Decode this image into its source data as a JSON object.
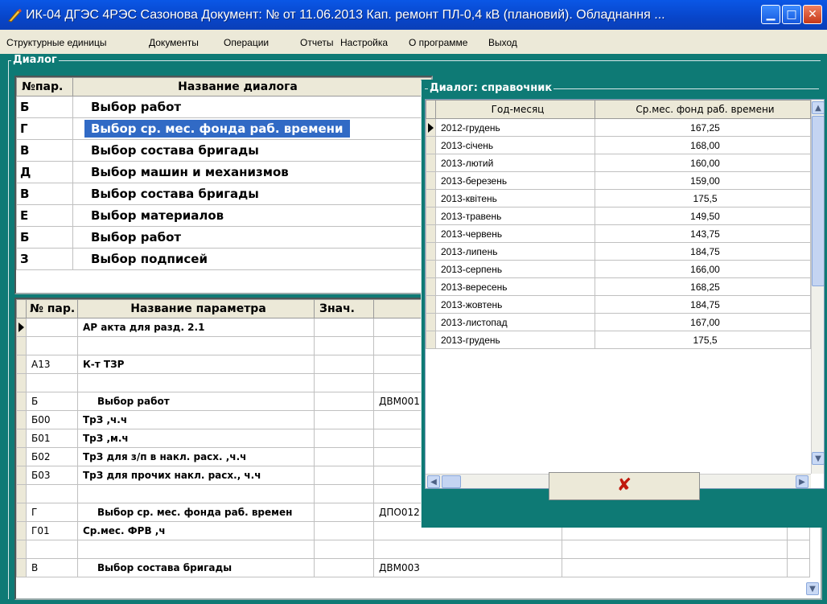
{
  "window": {
    "title": "ИК-04 ДГЭС 4РЭС Сазонова Документ: № от 11.06.2013   Кап. ремонт ПЛ-0,4 кВ (плановий). Обладнання ...",
    "minimize_glyph": "▁",
    "maximize_glyph": "□",
    "close_glyph": "✕"
  },
  "menu": [
    "Структурные единицы",
    "Документы",
    "Операции",
    "Отчеты",
    "Настройка",
    "О программе",
    "Выход"
  ],
  "dialogs_frame": {
    "label": "Диалог",
    "columns": [
      "№пар.",
      "Название диалога"
    ],
    "rows": [
      {
        "code": "Б",
        "name": "Выбор работ"
      },
      {
        "code": "Г",
        "name": "Выбор ср. мес. фонда раб. времени"
      },
      {
        "code": "В",
        "name": "Выбор состава бригады"
      },
      {
        "code": "Д",
        "name": "Выбор машин и механизмов"
      },
      {
        "code": "В",
        "name": "Выбор состава бригады"
      },
      {
        "code": "Е",
        "name": "Выбор материалов"
      },
      {
        "code": "Б",
        "name": "Выбор работ"
      },
      {
        "code": "З",
        "name": "Выбор подписей"
      }
    ],
    "selected_index": 1
  },
  "params": {
    "columns": [
      "№ пар.",
      "Название параметра",
      "Знач."
    ],
    "rows": [
      {
        "code": "",
        "name": "АР акта для разд. 2.1",
        "value": "",
        "extra": "",
        "current": true
      },
      {
        "code": "",
        "name": "",
        "value": "",
        "extra": ""
      },
      {
        "code": "А13",
        "name": "К-т ТЗР",
        "value": "",
        "extra": ""
      },
      {
        "code": "",
        "name": "",
        "value": "",
        "extra": ""
      },
      {
        "code": "Б",
        "name": "Выбор работ",
        "value": "",
        "extra": "ДВМ001"
      },
      {
        "code": "Б00",
        "name": "ТрЗ ,ч.ч",
        "value": "",
        "extra": ""
      },
      {
        "code": "Б01",
        "name": "ТрЗ ,м.ч",
        "value": "",
        "extra": ""
      },
      {
        "code": "Б02",
        "name": "ТрЗ для з/п в накл. расх. ,ч.ч",
        "value": "",
        "extra": ""
      },
      {
        "code": "Б03",
        "name": "ТрЗ для прочих накл. расх., ч.ч",
        "value": "",
        "extra": ""
      },
      {
        "code": "",
        "name": "",
        "value": "",
        "extra": ""
      },
      {
        "code": "Г",
        "name": "Выбор ср. мес. фонда раб. времен",
        "value": "",
        "extra": "ДПО012"
      },
      {
        "code": "Г01",
        "name": "Ср.мес. ФРВ ,ч",
        "value": "",
        "extra": ""
      },
      {
        "code": "",
        "name": "",
        "value": "",
        "extra": ""
      },
      {
        "code": "В",
        "name": "Выбор состава бригады",
        "value": "",
        "extra": "ДВМ003"
      }
    ]
  },
  "reference": {
    "label": "Диалог: справочник",
    "columns": [
      "Год-месяц",
      "Ср.мес. фонд раб. времени"
    ],
    "rows": [
      {
        "month": "2012-грудень",
        "value": "167,25",
        "current": true
      },
      {
        "month": "2013-січень",
        "value": "168,00"
      },
      {
        "month": "2013-лютий",
        "value": "160,00"
      },
      {
        "month": "2013-березень",
        "value": "159,00"
      },
      {
        "month": "2013-квітень",
        "value": "175,5"
      },
      {
        "month": "2013-травень",
        "value": "149,50"
      },
      {
        "month": "2013-червень",
        "value": "143,75"
      },
      {
        "month": "2013-липень",
        "value": "184,75"
      },
      {
        "month": "2013-серпень",
        "value": "166,00"
      },
      {
        "month": "2013-вересень",
        "value": "168,25"
      },
      {
        "month": "2013-жовтень",
        "value": "184,75"
      },
      {
        "month": "2013-листопад",
        "value": "167,00"
      },
      {
        "month": "2013-грудень",
        "value": "175,5"
      }
    ],
    "cancel_glyph": "✘"
  },
  "colors": {
    "background": "#0e7a75",
    "titlebar": "#0845c9",
    "selection": "#316ac5",
    "cancel_x": "#c0180c"
  }
}
